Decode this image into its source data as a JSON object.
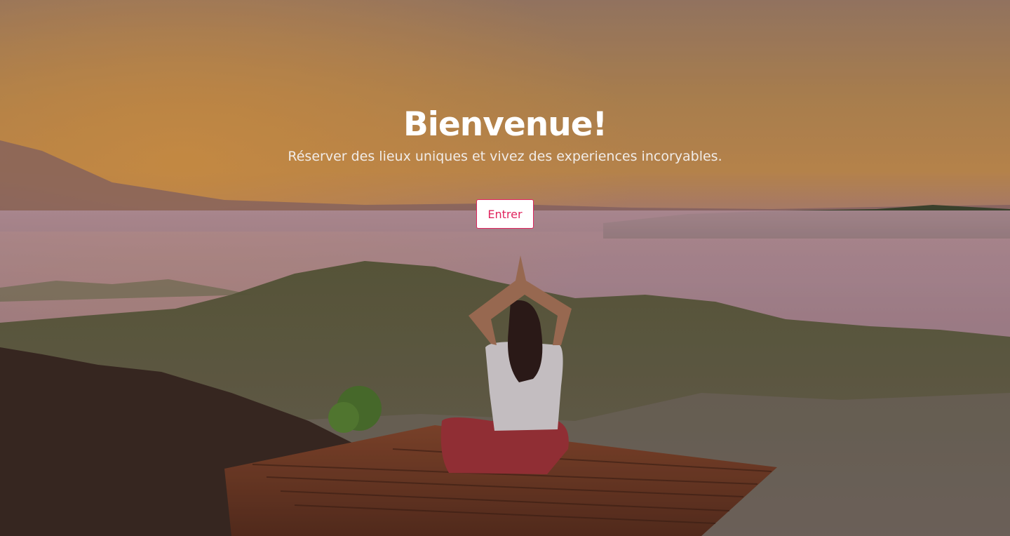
{
  "hero": {
    "title": "Bienvenue!",
    "subtitle": "Réserver des lieux uniques et vivez des experiences incoryables.",
    "enter_label": "Entrer",
    "accent_color": "#e0245e",
    "background_image": "yoga-at-sunrise-photo"
  }
}
